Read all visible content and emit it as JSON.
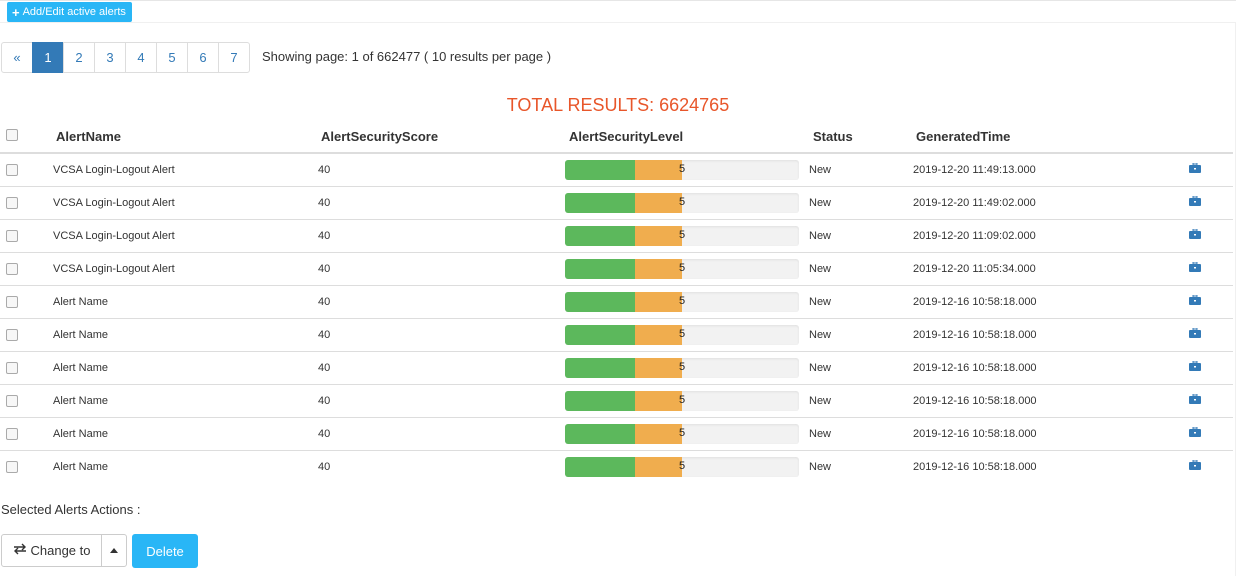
{
  "toolbar": {
    "add_label": "Add/Edit active alerts"
  },
  "pagination": {
    "prev": "«",
    "pages": [
      "1",
      "2",
      "3",
      "4",
      "5",
      "6",
      "7"
    ],
    "active_page": "1",
    "info": "Showing page: 1 of 662477 ( 10 results per page )"
  },
  "total_results": "TOTAL RESULTS: 6624765",
  "table": {
    "headers": [
      "AlertName",
      "AlertSecurityScore",
      "AlertSecurityLevel",
      "Status",
      "GeneratedTime"
    ],
    "rows": [
      {
        "name": "VCSA Login-Logout Alert",
        "score": "40",
        "level": "5",
        "status": "New",
        "time": "2019-12-20 11:49:13.000"
      },
      {
        "name": "VCSA Login-Logout Alert",
        "score": "40",
        "level": "5",
        "status": "New",
        "time": "2019-12-20 11:49:02.000"
      },
      {
        "name": "VCSA Login-Logout Alert",
        "score": "40",
        "level": "5",
        "status": "New",
        "time": "2019-12-20 11:09:02.000"
      },
      {
        "name": "VCSA Login-Logout Alert",
        "score": "40",
        "level": "5",
        "status": "New",
        "time": "2019-12-20 11:05:34.000"
      },
      {
        "name": "Alert Name",
        "score": "40",
        "level": "5",
        "status": "New",
        "time": "2019-12-16 10:58:18.000"
      },
      {
        "name": "Alert Name",
        "score": "40",
        "level": "5",
        "status": "New",
        "time": "2019-12-16 10:58:18.000"
      },
      {
        "name": "Alert Name",
        "score": "40",
        "level": "5",
        "status": "New",
        "time": "2019-12-16 10:58:18.000"
      },
      {
        "name": "Alert Name",
        "score": "40",
        "level": "5",
        "status": "New",
        "time": "2019-12-16 10:58:18.000"
      },
      {
        "name": "Alert Name",
        "score": "40",
        "level": "5",
        "status": "New",
        "time": "2019-12-16 10:58:18.000"
      },
      {
        "name": "Alert Name",
        "score": "40",
        "level": "5",
        "status": "New",
        "time": "2019-12-16 10:58:18.000"
      }
    ]
  },
  "actions": {
    "label": "Selected Alerts Actions :",
    "change_to": "Change to",
    "delete": "Delete"
  },
  "colors": {
    "accent": "#29b6f6",
    "pagination_active": "#337ab7",
    "total_text": "#e8562a",
    "level_green": "#5cb85c",
    "level_orange": "#f0ad4e",
    "briefcase_icon": "#337ab7"
  },
  "icons": {
    "add": "plus-icon",
    "row_action": "briefcase-icon",
    "change": "exchange-arrows-icon",
    "dropdown": "caret-down-icon"
  }
}
